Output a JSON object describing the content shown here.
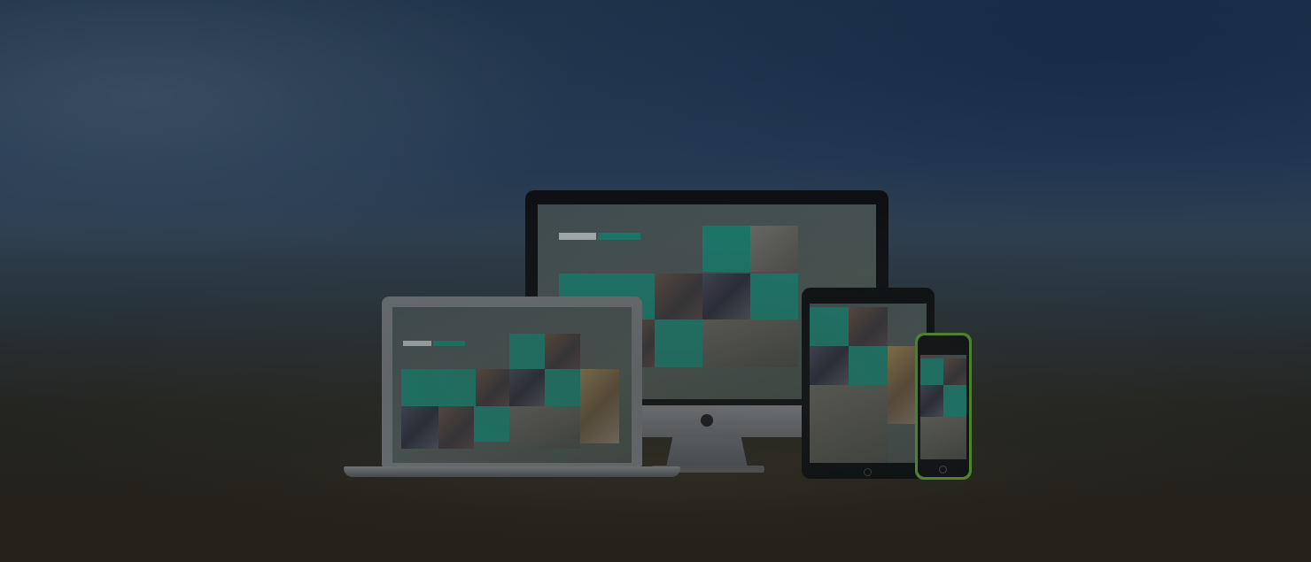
{
  "scene": {
    "description_tag": "responsive-devices-hero",
    "colors": {
      "accent_tile": "#1f8e7c",
      "sky_top": "#243b56",
      "floor": "#2b2519",
      "phone_case": "#5ea832"
    },
    "devices": [
      "imac",
      "laptop",
      "tablet",
      "phone"
    ]
  }
}
